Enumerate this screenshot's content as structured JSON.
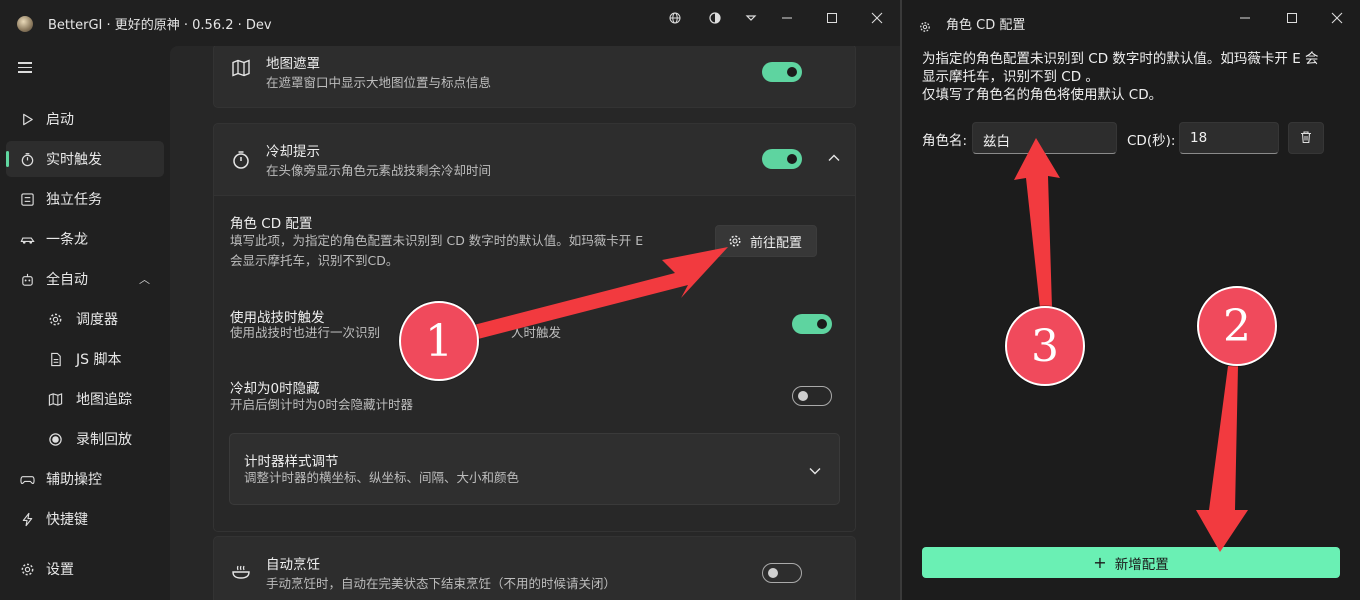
{
  "app": {
    "title": "BetterGI · 更好的原神 · 0.56.2 · Dev"
  },
  "sidebar": {
    "items": [
      {
        "label": "启动",
        "icon": "play-icon"
      },
      {
        "label": "实时触发",
        "icon": "timer-icon",
        "active": true
      },
      {
        "label": "独立任务",
        "icon": "task-list-icon"
      },
      {
        "label": "一条龙",
        "icon": "car-icon"
      },
      {
        "label": "全自动",
        "icon": "robot-icon",
        "expanded": true
      },
      {
        "label": "调度器",
        "icon": "gear-icon",
        "sub": true
      },
      {
        "label": "JS 脚本",
        "icon": "script-icon",
        "sub": true
      },
      {
        "label": "地图追踪",
        "icon": "map-icon",
        "sub": true
      },
      {
        "label": "录制回放",
        "icon": "record-icon",
        "sub": true
      },
      {
        "label": "辅助操控",
        "icon": "gamepad-icon"
      },
      {
        "label": "快捷键",
        "icon": "lightning-icon"
      },
      {
        "label": "设置",
        "icon": "settings-icon"
      }
    ]
  },
  "cards": {
    "map_mask": {
      "title": "地图遮罩",
      "desc": "在遮罩窗口中显示大地图位置与标点信息",
      "enabled": true
    },
    "cooldown": {
      "title": "冷却提示",
      "desc": "在头像旁显示角色元素战技剩余冷却时间",
      "enabled": true
    },
    "auto_cook": {
      "title": "自动烹饪",
      "desc": "手动烹饪时，自动在完美状态下结束烹饪（不用的时候请关闭）",
      "enabled": false
    }
  },
  "cooldown_panel": {
    "role_cd": {
      "title": "角色 CD 配置",
      "desc_line1": "填写此项，为指定的角色配置未识别到 CD 数字时的默认值。如玛薇卡开 E",
      "desc_line2": "会显示摩托车，识别不到CD。",
      "button_label": "前往配置"
    },
    "trigger_on_skill": {
      "title": "使用战技时触发",
      "desc": "使用战技时也进行一次识别",
      "desc_tail": "人时触发",
      "enabled": true
    },
    "hide_at_zero": {
      "title": "冷却为0时隐藏",
      "desc": "开启后倒计时为0时会隐藏计时器",
      "enabled": false
    },
    "timer_style": {
      "title": "计时器样式调节",
      "desc": "调整计时器的横坐标、纵坐标、间隔、大小和颜色"
    }
  },
  "dialog": {
    "title": "角色 CD 配置",
    "text_line1": "为指定的角色配置未识别到 CD 数字时的默认值。如玛薇卡开 E 会",
    "text_line2": "显示摩托车，识别不到 CD 。",
    "text_line3": "仅填写了角色名的角色将使用默认 CD。",
    "name_label": "角色名:",
    "name_value": "兹白",
    "cd_label": "CD(秒):",
    "cd_value": "18",
    "add_button": "新增配置"
  },
  "annotations": {
    "badge_1": "1",
    "badge_2": "2",
    "badge_3": "3",
    "arrow_color": "#f03a3f"
  },
  "colors": {
    "accent": "#60d7a0",
    "add_button": "#6af0b4",
    "badge": "#f04a5c"
  }
}
